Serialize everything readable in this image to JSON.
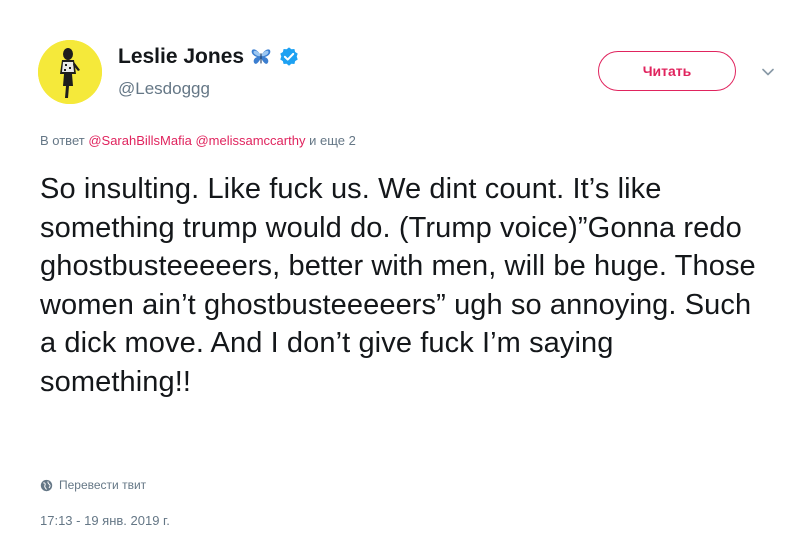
{
  "author": {
    "display_name": "Leslie Jones",
    "handle": "@Lesdoggg",
    "avatar_bg": "#f5e93a",
    "badges": [
      "butterfly-icon",
      "verified-icon"
    ]
  },
  "follow_button": {
    "label": "Читать",
    "color": "#e0245e"
  },
  "reply": {
    "prefix": "В ответ",
    "mention_1": "@SarahBillsMafia",
    "mention_2": "@melissamccarthy",
    "suffix": "и еще 2"
  },
  "tweet": {
    "text": "So insulting. Like fuck us. We dint count. It’s like something trump would do. (Trump voice)”Gonna redo ghostbusteeeeers, better with men, will be huge. Those women ain’t ghostbusteeeeers” ugh so annoying. Such a dick move. And I don’t give fuck I’m saying something!!"
  },
  "translate": {
    "label": "Перевести твит",
    "icon": "globe-icon"
  },
  "timestamp": "17:13 - 19 янв. 2019 г."
}
